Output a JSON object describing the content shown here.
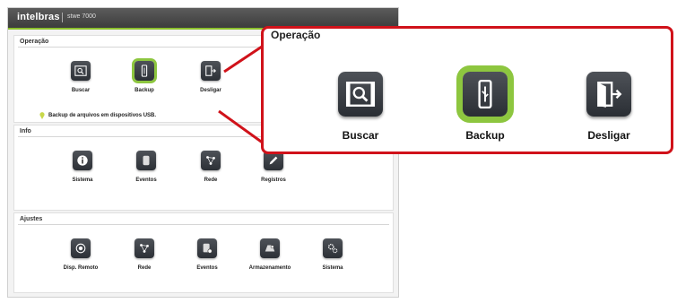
{
  "app": {
    "brand": "intelbras",
    "model": "stwe 7000"
  },
  "operacao": {
    "title": "Operação",
    "items": [
      {
        "label": "Buscar",
        "icon": "search-film-icon"
      },
      {
        "label": "Backup",
        "icon": "usb-icon"
      },
      {
        "label": "Desligar",
        "icon": "exit-door-icon"
      }
    ],
    "hint": "Backup de arquivos em dispositivos USB."
  },
  "info": {
    "title": "Info",
    "items": [
      {
        "label": "Sistema",
        "icon": "info-icon"
      },
      {
        "label": "Eventos",
        "icon": "hdd-icon"
      },
      {
        "label": "Rede",
        "icon": "network-icon"
      },
      {
        "label": "Registros",
        "icon": "pen-icon"
      }
    ]
  },
  "ajustes": {
    "title": "Ajustes",
    "items": [
      {
        "label": "Disp. Remoto",
        "icon": "camera-icon"
      },
      {
        "label": "Rede",
        "icon": "network-icon"
      },
      {
        "label": "Eventos",
        "icon": "disk-gear-icon"
      },
      {
        "label": "Armazenamento",
        "icon": "storage-icon"
      },
      {
        "label": "Sistema",
        "icon": "gears-icon"
      }
    ]
  },
  "zoom": {
    "title": "Operação",
    "items": [
      {
        "label": "Buscar"
      },
      {
        "label": "Backup"
      },
      {
        "label": "Desligar"
      }
    ]
  },
  "colors": {
    "accent": "#8dc63f",
    "callout": "#d0121a",
    "icon_bg": "#3a3e44"
  }
}
